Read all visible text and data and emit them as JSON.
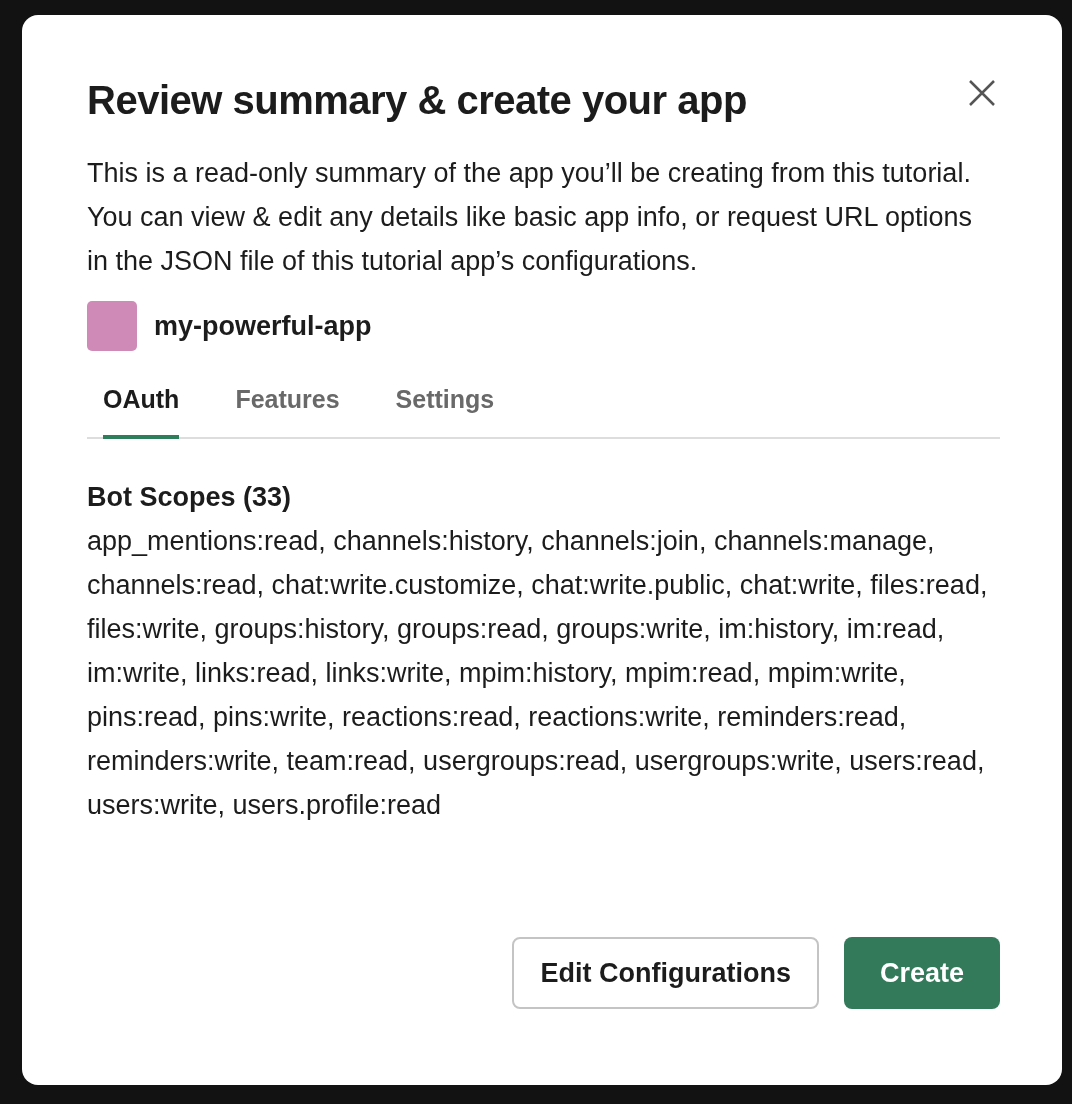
{
  "dialog": {
    "title": "Review summary & create your app",
    "description": "This is a read-only summary of the app you’ll be creating from this tutorial. You can view & edit any details like basic app info, or request URL options in the JSON file of this tutorial app’s configurations.",
    "app": {
      "name": "my-powerful-app",
      "color": "#d08ab8"
    },
    "tabs": [
      {
        "label": "OAuth",
        "selected": true
      },
      {
        "label": "Features",
        "selected": false
      },
      {
        "label": "Settings",
        "selected": false
      }
    ],
    "section": {
      "heading": "Bot Scopes (33)",
      "text": "app_mentions:read, channels:history, channels:join, channels:manage, channels:read, chat:write.customize, chat:write.public, chat:write, files:read, files:write, groups:history, groups:read, groups:write, im:history, im:read, im:write, links:read, links:write, mpim:history, mpim:read, mpim:write, pins:read, pins:write, reactions:read, reactions:write, reminders:read, reminders:write, team:read, usergroups:read, usergroups:write, users:read, users:write, users.profile:read"
    },
    "buttons": [
      {
        "label": "Edit Configurations",
        "kind": "secondary"
      },
      {
        "label": "Create",
        "kind": "primary"
      }
    ]
  }
}
